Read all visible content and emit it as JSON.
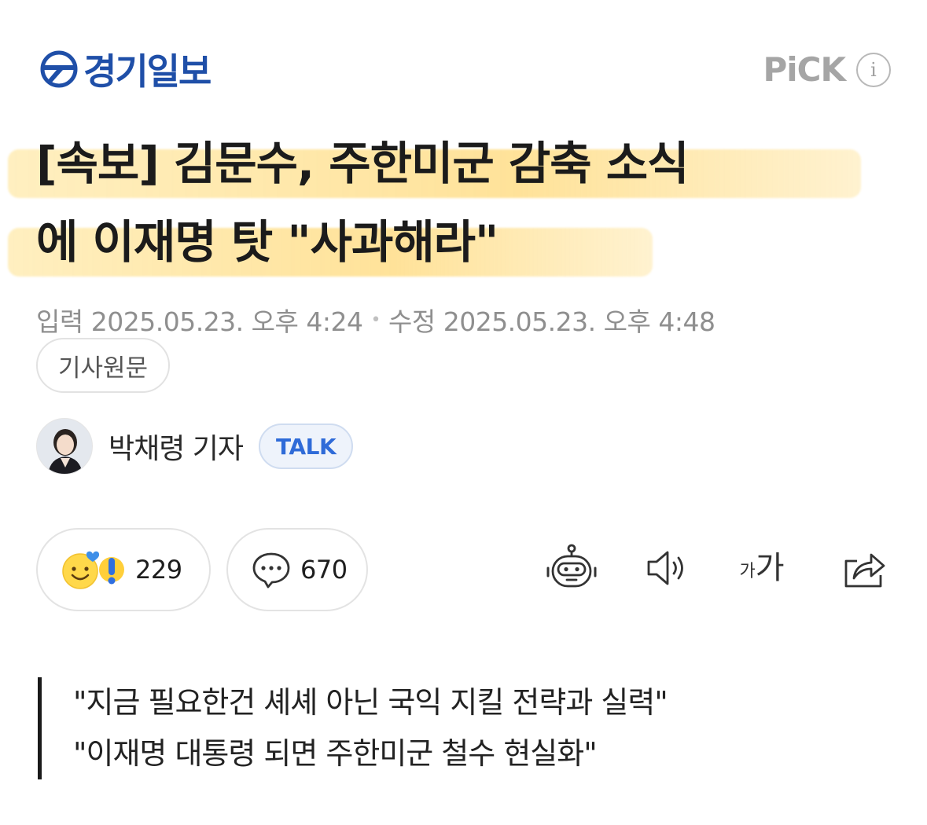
{
  "header": {
    "publisher_name": "경기일보",
    "pick_label": "PiCK",
    "info_icon": "i"
  },
  "article": {
    "headline_line1": "[속보] 김문수, 주한미군 감축 소식",
    "headline_line2": "에 이재명 탓 \"사과해라\"",
    "input_label": "입력",
    "input_datetime": "2025.05.23. 오후 4:24",
    "separator": "•",
    "modified_label": "수정",
    "modified_datetime": "2025.05.23. 오후 4:48",
    "original_button": "기사원문",
    "author_name": "박채령 기자",
    "talk_button": "TALK",
    "subheads": [
      "\"지금 필요한건 셰셰 아닌 국익 지킬 전략과 실력\"",
      "\"이재명 대통령 되면 주한미군 철수 현실화\""
    ]
  },
  "actions": {
    "reaction_count": "229",
    "comment_count": "670",
    "font_small": "가",
    "font_large": "가"
  },
  "icons": {
    "logo": "gyeonggi-ilbo-logo-icon",
    "reaction": "emoji-reaction-icon",
    "comment": "speech-bubble-icon",
    "summary_bot": "robot-icon",
    "tts": "speaker-icon",
    "font_size": "font-size-icon",
    "share": "share-icon"
  },
  "colors": {
    "brand_blue": "#1f4fa8",
    "highlight_yellow": "#ffd66e",
    "talk_blue": "#2f6bd8",
    "meta_gray": "#8f8f8f"
  }
}
